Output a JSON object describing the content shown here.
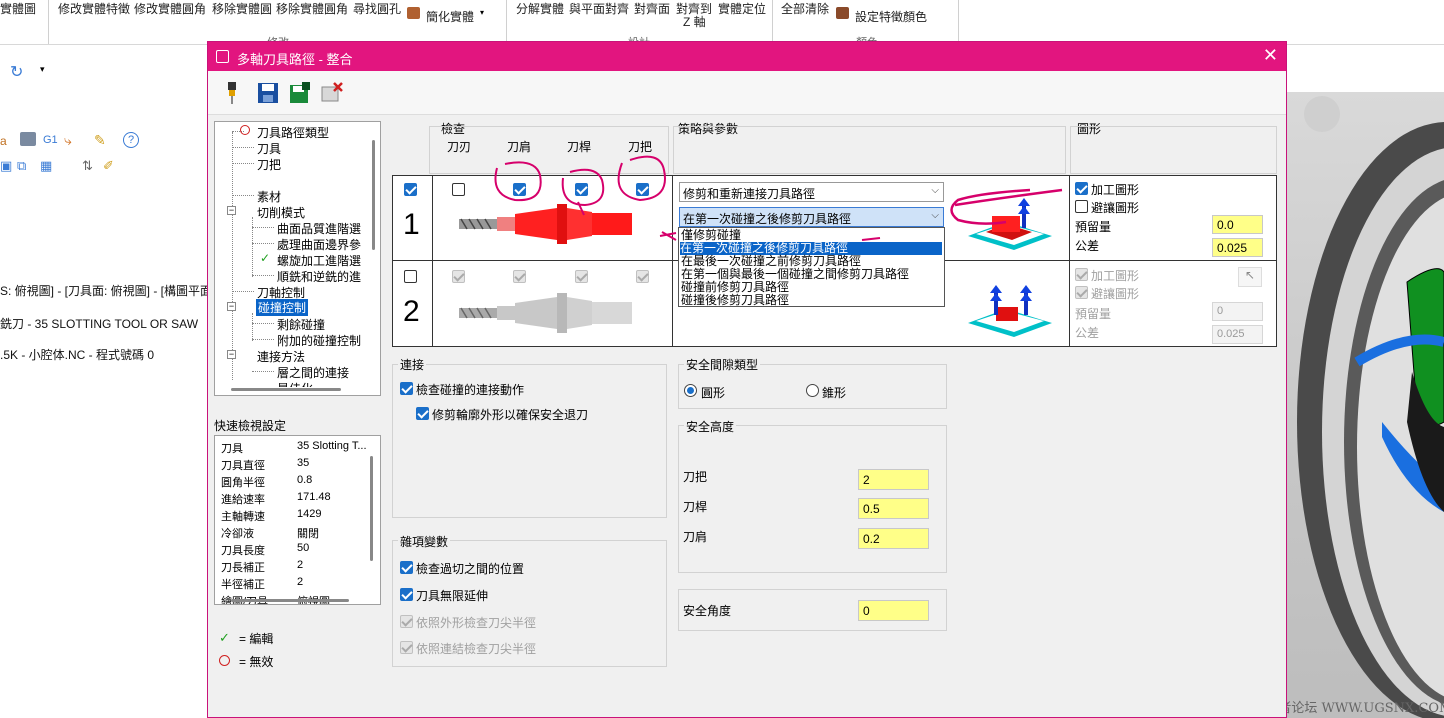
{
  "ribbon": {
    "buttons": [
      "實體圖",
      "修改實體特徵",
      "修改實體圓角",
      "移除實體圓",
      "移除實體圓角",
      "尋找圓孔",
      "簡化實體",
      "分解實體",
      "與平面對齊",
      "對齊面",
      "對齊到",
      "實體定位",
      "Z 軸",
      "全部清除",
      "設定特徵顏色"
    ],
    "groups": [
      "修改",
      "設計",
      "顏色"
    ]
  },
  "background": {
    "line1": "S: 俯視圖] - [刀具面: 俯視圖] - [構圖平面",
    "line2": "銑刀 - 35 SLOTTING TOOL OR SAW",
    "line3": ".5K - 小腔体.NC - 程式號碼 0",
    "g1_label": "G1"
  },
  "watermark": "UG爱好者论坛 WWW.UGSNX.COM",
  "dialog": {
    "title": "多軸刀具路徑 - 整合",
    "close": "✕"
  },
  "tree": {
    "items": [
      "刀具路徑類型",
      "刀具",
      "刀把",
      "素材",
      "切削模式",
      "曲面品質進階選",
      "處理曲面邊界參",
      "螺旋加工進階選",
      "順銑和逆銑的進",
      "刀軸控制",
      "碰撞控制",
      "剩餘碰撞",
      "附加的碰撞控制",
      "連接方法",
      "層之間的連接",
      "最佳化..."
    ]
  },
  "quick_view": {
    "title": "快速檢視設定",
    "rows": [
      {
        "k": "刀具",
        "v": "35 Slotting T..."
      },
      {
        "k": "刀具直徑",
        "v": "35"
      },
      {
        "k": "圓角半徑",
        "v": "0.8"
      },
      {
        "k": "進給速率",
        "v": "171.48"
      },
      {
        "k": "主軸轉速",
        "v": "1429"
      },
      {
        "k": "冷卻液",
        "v": "關閉"
      },
      {
        "k": "刀具長度",
        "v": "50"
      },
      {
        "k": "刀長補正",
        "v": "2"
      },
      {
        "k": "半徑補正",
        "v": "2"
      },
      {
        "k": "繪圖/刀具",
        "v": "俯視圖"
      }
    ]
  },
  "legend": {
    "edited": "= 編輯",
    "invalid": "= 無效"
  },
  "grid": {
    "check_header": "檢查",
    "cols": [
      "刀刃",
      "刀肩",
      "刀桿",
      "刀把"
    ],
    "strategy_header": "策略與參數",
    "graphics_header": "圖形",
    "row1": {
      "num": "1",
      "combo1": "修剪和重新連接刀具路徑",
      "combo2": "在第一次碰撞之後修剪刀具路徑",
      "dropdown_options": [
        "僅修剪碰撞",
        "在第一次碰撞之後修剪刀具路徑",
        "在最後一次碰撞之前修剪刀具路徑",
        "在第一個與最後一個碰撞之間修剪刀具路徑",
        "碰撞前修剪刀具路徑",
        "碰撞後修剪刀具路徑"
      ],
      "selected_option": 1,
      "cut_graphics": "加工圖形",
      "avoid_graphics": "避讓圖形",
      "stock_label": "預留量",
      "stock_value": "0.0",
      "tol_label": "公差",
      "tol_value": "0.025"
    },
    "row2": {
      "num": "2",
      "cut_graphics": "加工圖形",
      "avoid_graphics": "避讓圖形",
      "stock_label": "預留量",
      "stock_value": "0",
      "tol_label": "公差",
      "tol_value": "0.025"
    }
  },
  "connection": {
    "title": "連接",
    "opt1": "檢查碰撞的連接動作",
    "opt2": "修剪輪廓外形以確保安全退刀"
  },
  "misc": {
    "title": "雜項變數",
    "opt1": "檢查過切之間的位置",
    "opt2": "刀具無限延伸",
    "opt3": "依照外形檢查刀尖半徑",
    "opt4": "依照連結檢查刀尖半徑"
  },
  "clearance_type": {
    "title": "安全間隙類型",
    "opt1": "圓形",
    "opt2": "錐形"
  },
  "clearance_height": {
    "title": "安全高度",
    "holder_label": "刀把",
    "holder_value": "2",
    "shank_label": "刀桿",
    "shank_value": "0.5",
    "shoulder_label": "刀肩",
    "shoulder_value": "0.2"
  },
  "safety_angle": {
    "label": "安全角度",
    "value": "0"
  },
  "colors": {
    "title_bar": "#e2157f",
    "annotation": "#d6006b",
    "check_blue": "#1a6fc9",
    "field_yellow": "#ffff88"
  }
}
